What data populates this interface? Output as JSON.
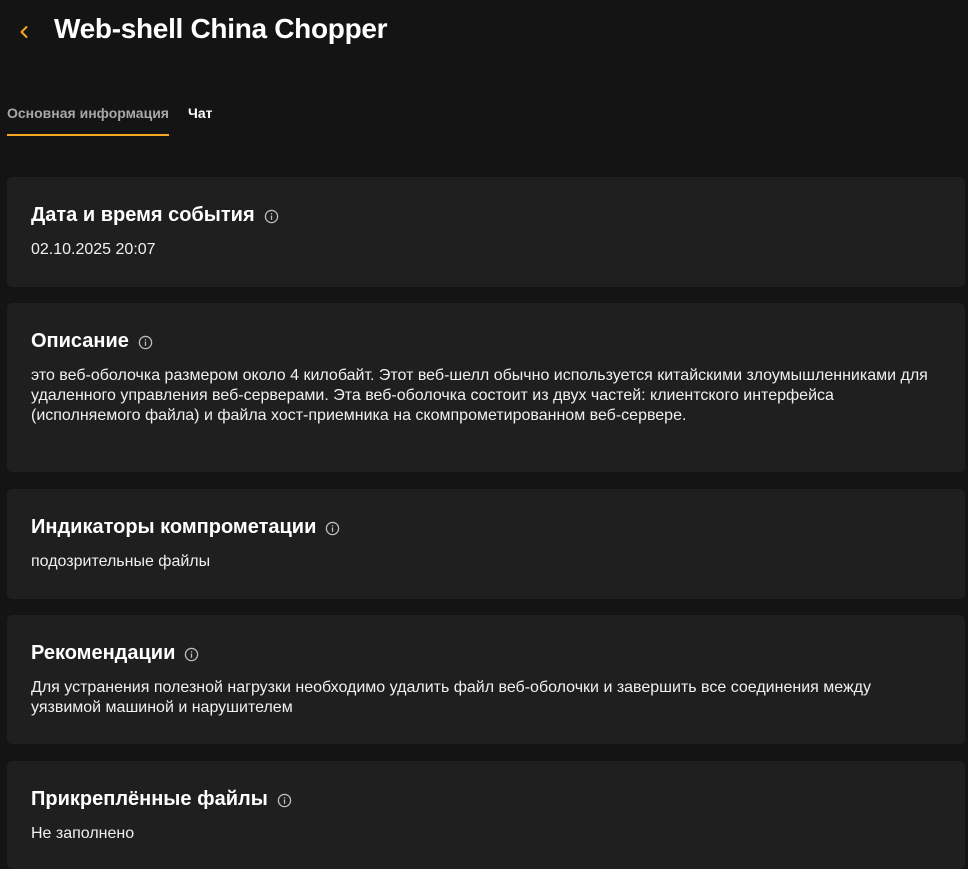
{
  "header": {
    "title": "Web-shell China Chopper",
    "back_icon": "chevron-left-icon",
    "accent_color": "#f5a623"
  },
  "tabs": [
    {
      "label": "Основная информация",
      "active": true
    },
    {
      "label": "Чат",
      "active": false
    }
  ],
  "sections": {
    "event_datetime": {
      "title": "Дата и время события",
      "value": "02.10.2025 20:07"
    },
    "description": {
      "title": "Описание",
      "value": "это веб-оболочка размером около 4 килобайт. Этот веб-шелл обычно используется китайскими злоумышленниками для удаленного управления веб-серверами. Эта веб-оболочка состоит из двух частей: клиентского интерфейса (исполняемого файла) и файла хост-приемника на скомпрометированном веб-сервере."
    },
    "indicators": {
      "title": "Индикаторы компрометации",
      "value": "подозрительные файлы"
    },
    "recommendations": {
      "title": "Рекомендации",
      "value": "Для устранения полезной нагрузки необходимо удалить файл веб-оболочки и завершить все соединения между уязвимой машиной и нарушителем"
    },
    "attachments": {
      "title": "Прикреплённые файлы",
      "value": "Не заполнено"
    }
  },
  "colors": {
    "background": "#141414",
    "card": "#1f1f1f",
    "accent": "#f5a623"
  }
}
